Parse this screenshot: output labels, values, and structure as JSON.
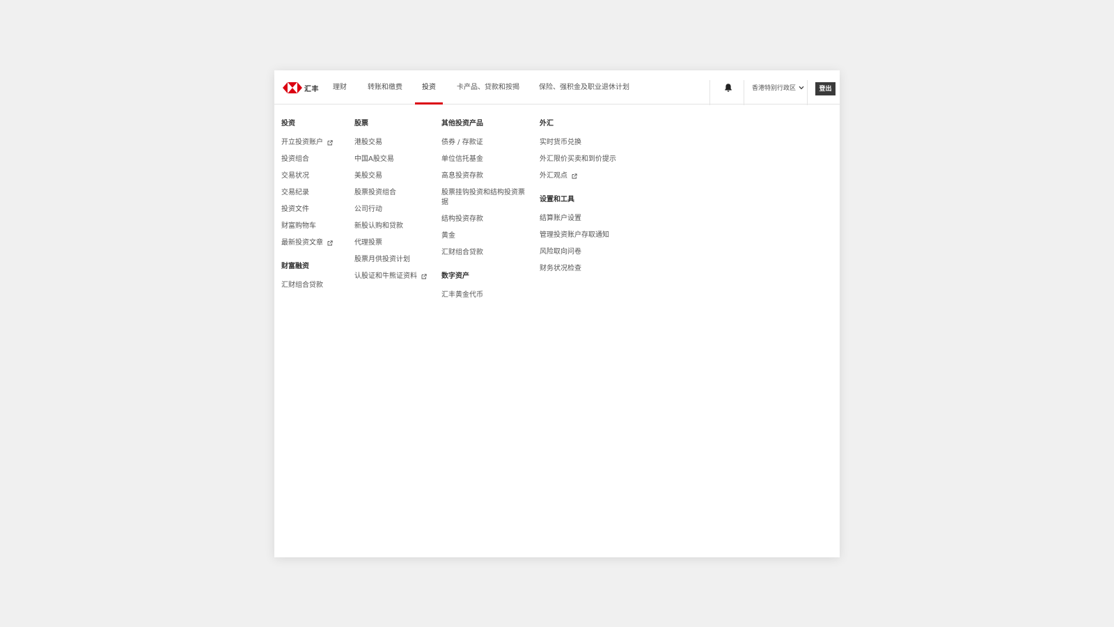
{
  "brand": {
    "name": "汇丰",
    "accent_color": "#db0011"
  },
  "nav": {
    "items": [
      {
        "label": "理财"
      },
      {
        "label": "转账和缴费"
      },
      {
        "label": "投资"
      },
      {
        "label": "卡产品、贷款和按揭"
      },
      {
        "label": "保险、强积金及职业退休计划"
      }
    ],
    "active": "投资",
    "region": "香港特别行政区",
    "logout_label": "登出",
    "bell_icon": "bell-icon"
  },
  "menu": {
    "columns": [
      {
        "groups": [
          {
            "title": "投资",
            "links": [
              {
                "label": "开立投资账户",
                "external": true
              },
              {
                "label": "投资组合",
                "external": false
              },
              {
                "label": "交易状况",
                "external": false
              },
              {
                "label": "交易纪录",
                "external": false
              },
              {
                "label": "投资文件",
                "external": false
              },
              {
                "label": "财富购物车",
                "external": false
              },
              {
                "label": "最新投资文章",
                "external": true
              }
            ]
          },
          {
            "title": "财富融资",
            "links": [
              {
                "label": "汇财组合贷款",
                "external": false
              }
            ]
          }
        ]
      },
      {
        "groups": [
          {
            "title": "股票",
            "links": [
              {
                "label": "港股交易",
                "external": false
              },
              {
                "label": "中国A股交易",
                "external": false
              },
              {
                "label": "美股交易",
                "external": false
              },
              {
                "label": "股票投资组合",
                "external": false
              },
              {
                "label": "公司行动",
                "external": false
              },
              {
                "label": "新股认购和贷款",
                "external": false
              },
              {
                "label": "代理投票",
                "external": false
              },
              {
                "label": "股票月供投资计划",
                "external": false
              },
              {
                "label": "认股证和牛熊证资料",
                "external": true
              }
            ]
          }
        ]
      },
      {
        "groups": [
          {
            "title": "其他投资产品",
            "links": [
              {
                "label": "债券 / 存款证",
                "external": false
              },
              {
                "label": "单位信托基金",
                "external": false
              },
              {
                "label": "高息投资存款",
                "external": false
              },
              {
                "label": "股票挂钩投资和结构投资票据",
                "external": false
              },
              {
                "label": "结构投资存款",
                "external": false
              },
              {
                "label": "黄金",
                "external": false
              },
              {
                "label": "汇财组合贷款",
                "external": false
              }
            ]
          },
          {
            "title": "数字资产",
            "links": [
              {
                "label": "汇丰黄金代币",
                "external": false
              }
            ]
          }
        ]
      },
      {
        "groups": [
          {
            "title": "外汇",
            "links": [
              {
                "label": "实时货币兑换",
                "external": false
              },
              {
                "label": "外汇限价买卖和到价提示",
                "external": false
              },
              {
                "label": "外汇观点",
                "external": true
              }
            ]
          },
          {
            "title": "设置和工具",
            "links": [
              {
                "label": "结算账户设置",
                "external": false
              },
              {
                "label": "管理投资账户存取通知",
                "external": false
              },
              {
                "label": "风险取向问卷",
                "external": false
              },
              {
                "label": "财务状况检查",
                "external": false
              }
            ]
          }
        ]
      }
    ]
  }
}
